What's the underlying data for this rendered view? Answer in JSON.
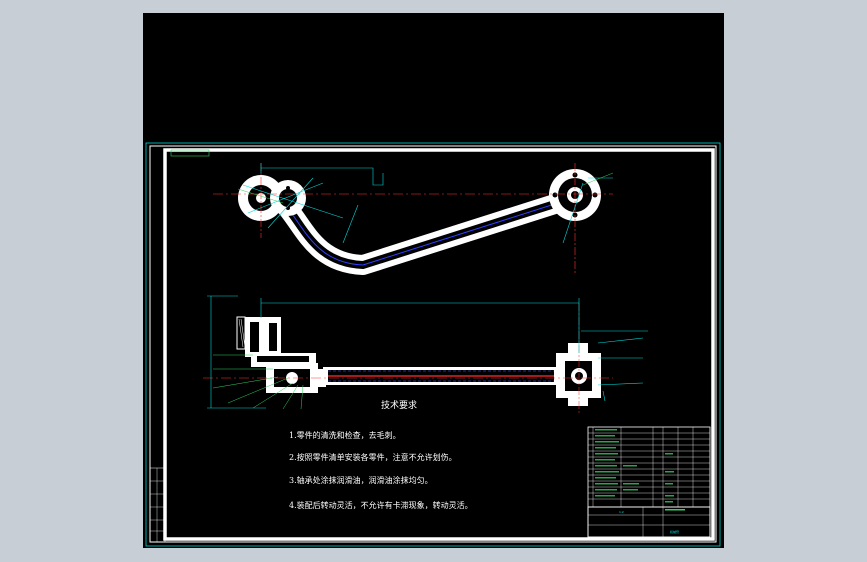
{
  "drawing": {
    "tech_requirements": {
      "heading": "技术要求",
      "items": [
        "1.零件的清洗和检查，去毛刺。",
        "2.按照零件清单安装各零件，注意不允许划伤。",
        "3.轴承处涂抹润滑油，润滑油涂抹均匀。",
        "4.装配后转动灵活，不允许有卡滞现象，转动灵活。"
      ]
    },
    "title_block": {
      "part_name": "机械臂",
      "scale": "1:2"
    }
  },
  "colors": {
    "background": "#000000",
    "frame": "#ffffff",
    "dimension": "#00d8d8",
    "leader": "#30d060",
    "centerline": "#ff3030",
    "hidden": "#5060ff"
  }
}
